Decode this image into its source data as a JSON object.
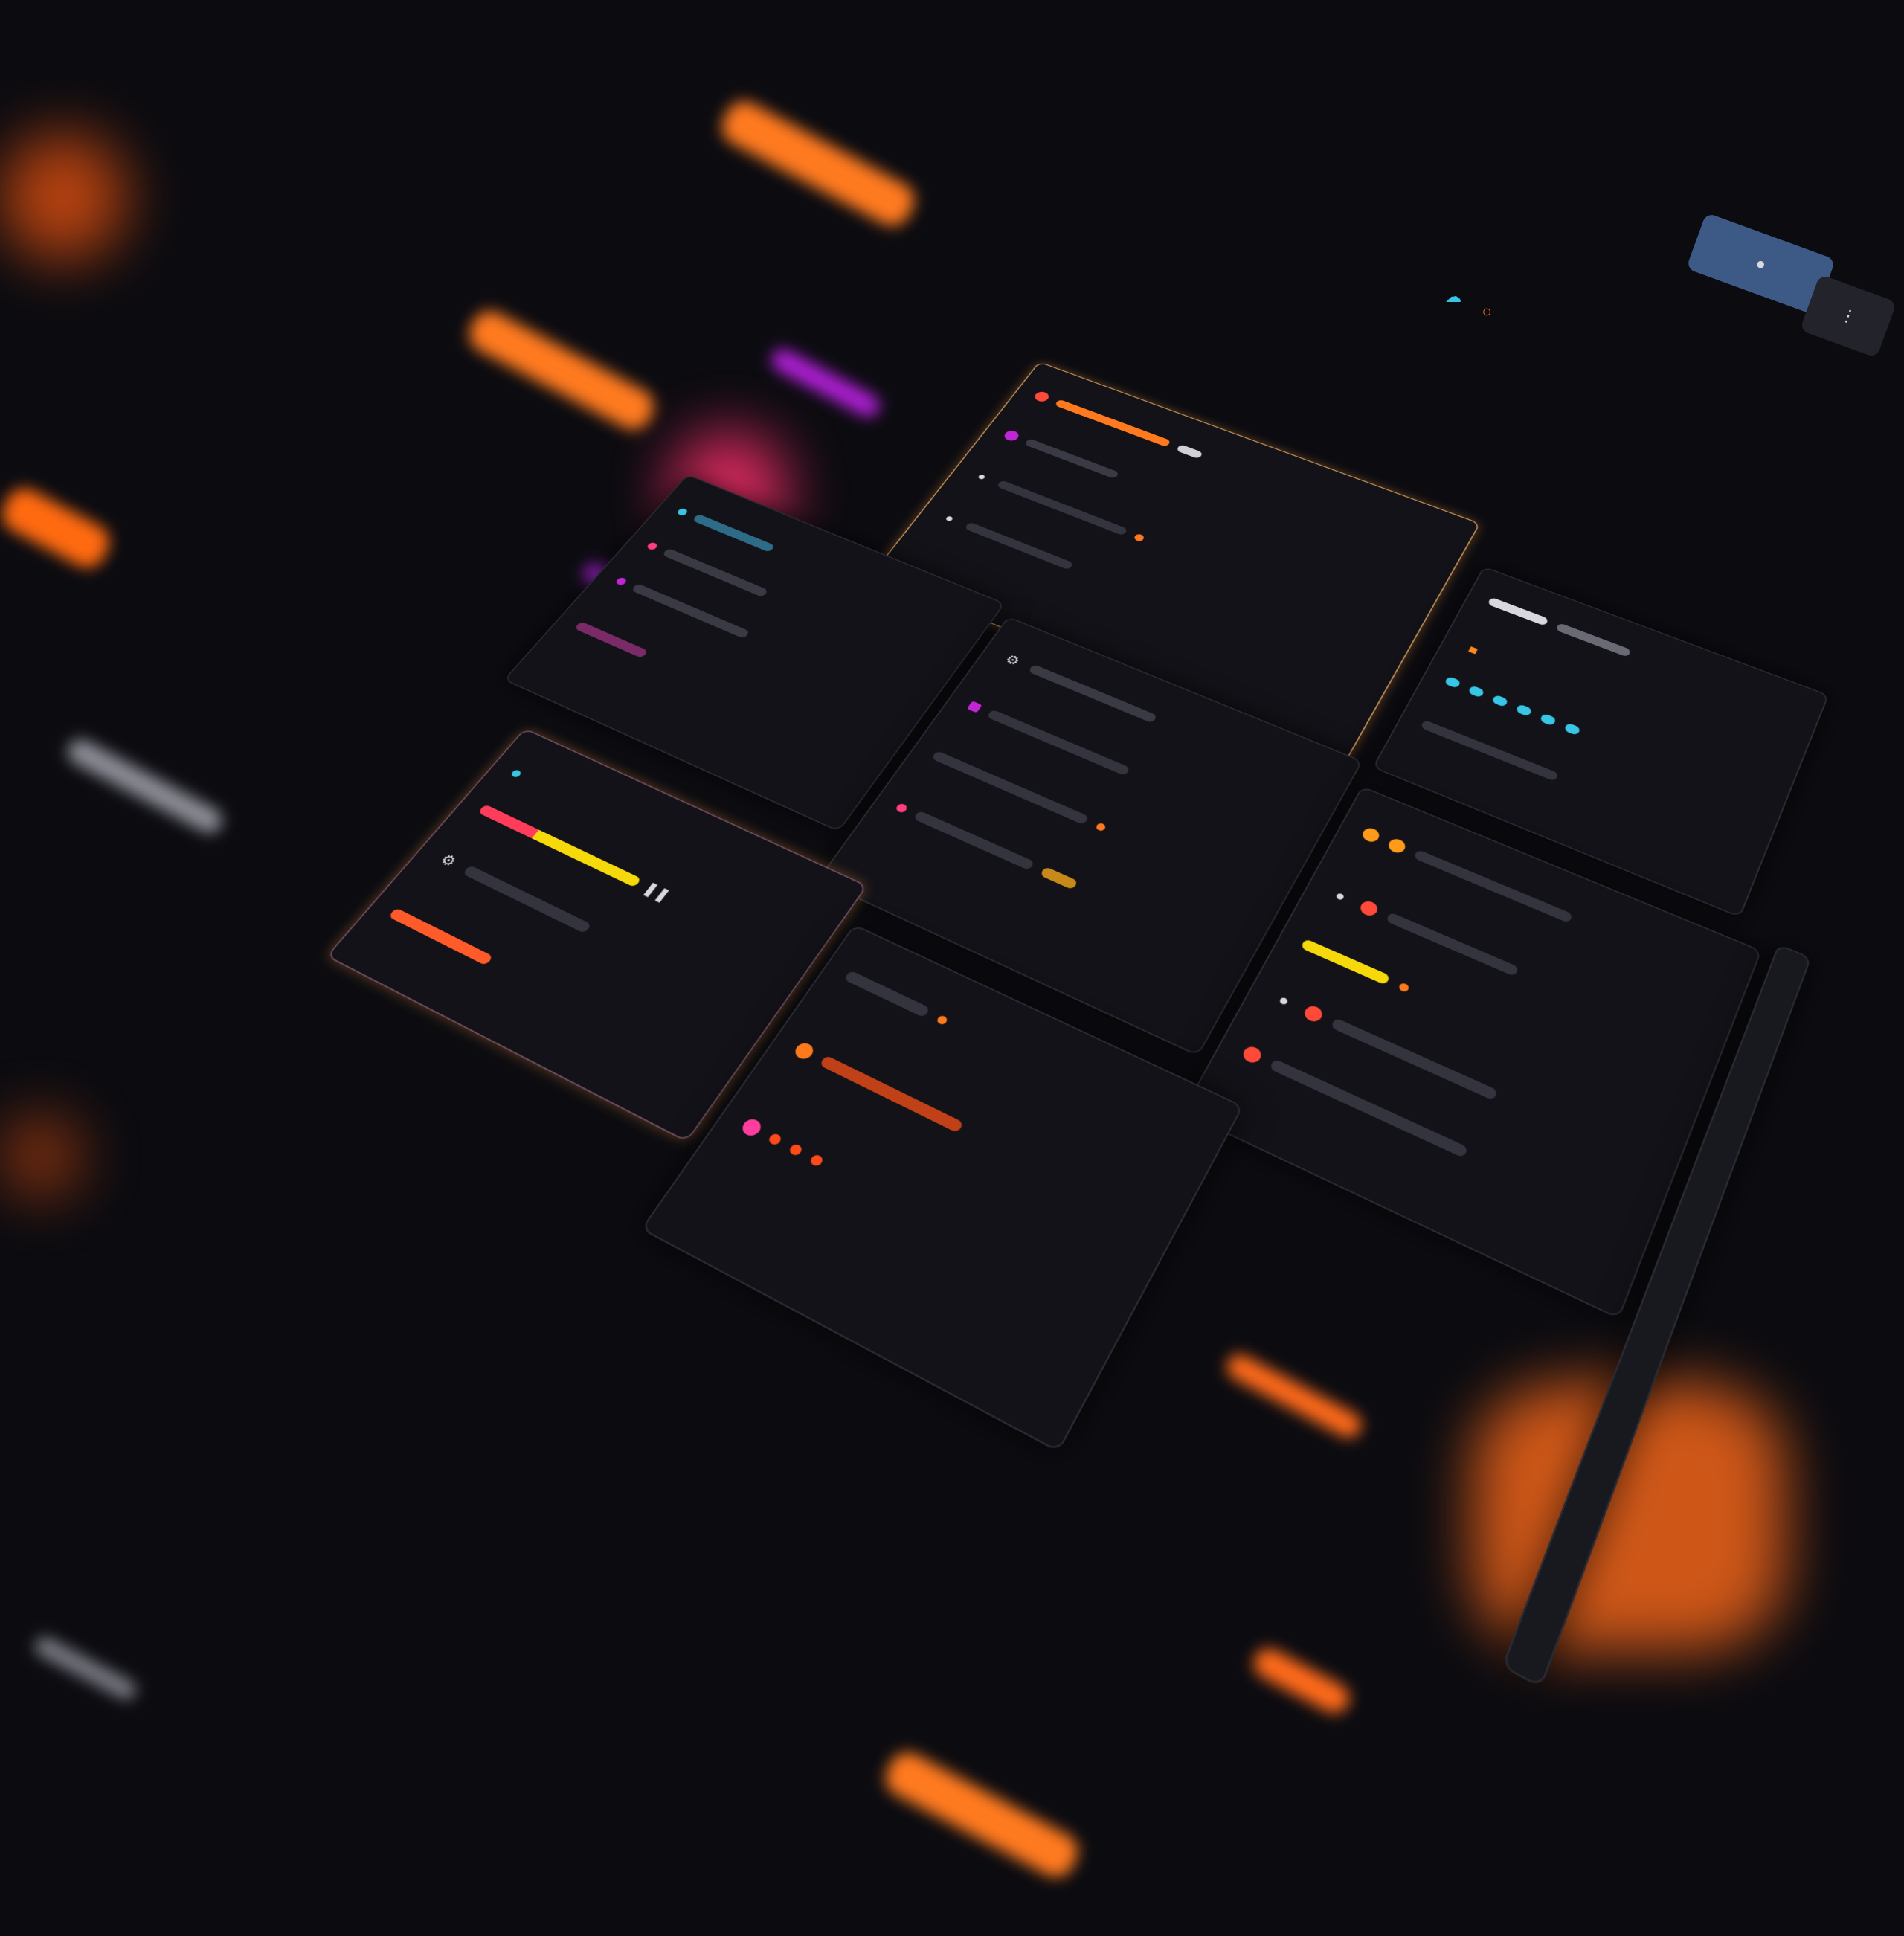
{
  "colors": {
    "background": "#0b0b10",
    "panel": "#121218",
    "accent_orange": "#ff6a1a",
    "accent_magenta": "#c026d3",
    "accent_pink": "#ff3d7f",
    "accent_cyan": "#37c6e6",
    "accent_yellow": "#f5d90a",
    "button_blue": "#3d5a87"
  },
  "icons": [
    "user-icon",
    "bell-icon",
    "settings-icon",
    "pause-icon",
    "menu-icon",
    "cloud-icon",
    "lock-icon"
  ],
  "progress": {
    "main_track_fraction": 0.62,
    "yellow_segment_fraction": 0.35
  },
  "text": {}
}
